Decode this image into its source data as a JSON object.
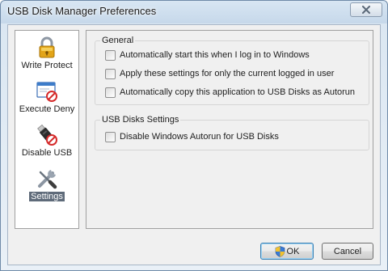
{
  "window": {
    "title": "USB Disk Manager Preferences"
  },
  "sidebar": {
    "items": [
      {
        "label": "Write Protect",
        "icon": "padlock-icon",
        "selected": false
      },
      {
        "label": "Execute Deny",
        "icon": "window-deny-icon",
        "selected": false
      },
      {
        "label": "Disable USB",
        "icon": "usb-drive-icon",
        "selected": false
      },
      {
        "label": "Settings",
        "icon": "tools-icon",
        "selected": true
      }
    ]
  },
  "general": {
    "title": "General",
    "options": [
      {
        "label": "Automatically start this when I log in to Windows",
        "checked": false
      },
      {
        "label": "Apply these settings for only the current logged in user",
        "checked": false
      },
      {
        "label": "Automatically copy this application to USB Disks as Autorun",
        "checked": false
      }
    ]
  },
  "usb_settings": {
    "title": "USB Disks Settings",
    "options": [
      {
        "label": "Disable Windows Autorun for USB Disks",
        "checked": false
      }
    ]
  },
  "buttons": {
    "ok": "OK",
    "cancel": "Cancel"
  },
  "colors": {
    "selection": "#5f6b7a",
    "titlebar": "#c6d8ea"
  }
}
